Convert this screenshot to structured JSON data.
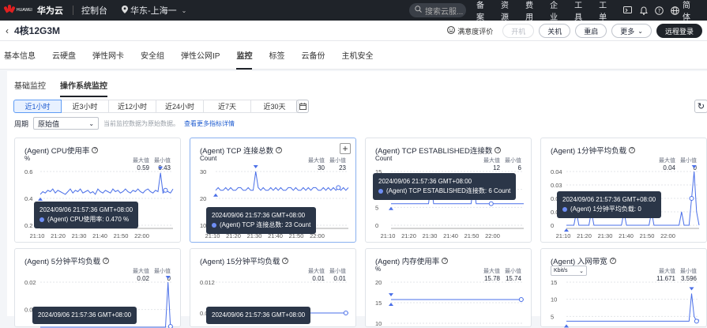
{
  "topbar": {
    "logo_text_line1": "HUAWEI",
    "brand": "华为云",
    "console": "控制台",
    "region": "华东-上海一",
    "search_placeholder": "搜索云服...",
    "links": [
      "备案",
      "资源",
      "费用",
      "企业",
      "工具",
      "工单"
    ],
    "lang": "简体"
  },
  "header": {
    "instance_title": "4核12G3M",
    "rate_label": "满意度评价",
    "buttons": [
      "开机",
      "关机",
      "重启",
      "更多",
      "远程登录"
    ]
  },
  "tabs": [
    "基本信息",
    "云硬盘",
    "弹性网卡",
    "安全组",
    "弹性公网IP",
    "监控",
    "标签",
    "云备份",
    "主机安全"
  ],
  "active_tab": "监控",
  "subtabs": [
    "基础监控",
    "操作系统监控"
  ],
  "active_subtab": "操作系统监控",
  "time_ranges": [
    "近1小时",
    "近3小时",
    "近12小时",
    "近24小时",
    "近7天",
    "近30天"
  ],
  "active_range": "近1小时",
  "period": {
    "label": "周期",
    "value": "原始值",
    "hint": "当前监控数据为原始数据。",
    "link": "查看更多指标详情"
  },
  "stat_labels": {
    "max": "最大值",
    "min": "最小值"
  },
  "cards": [
    {
      "title": "(Agent) CPU使用率",
      "unit": "%",
      "max": "0.59",
      "min": "0.43",
      "y_ticks": [
        "0.6",
        "0.4",
        "0.2"
      ],
      "x_ticks": [
        "21:10",
        "21:20",
        "21:30",
        "21:40",
        "21:50",
        "22:00"
      ],
      "tooltip_time": "2024/09/06 21:57:36 GMT+08:00",
      "tooltip_value": "(Agent) CPU使用率: 0.470 %",
      "series": [
        0.43,
        0.45,
        0.44,
        0.46,
        0.45,
        0.47,
        0.44,
        0.46,
        0.45,
        0.44,
        0.43,
        0.45,
        0.47,
        0.44,
        0.46,
        0.45,
        0.47,
        0.44,
        0.45,
        0.46,
        0.44,
        0.45,
        0.43,
        0.47,
        0.45,
        0.44,
        0.46,
        0.45,
        0.44,
        0.47,
        0.45,
        0.46,
        0.44,
        0.45,
        0.47,
        0.45,
        0.44,
        0.46,
        0.45,
        0.47,
        0.45,
        0.44,
        0.46,
        0.47,
        0.45,
        0.44,
        0.46,
        0.45,
        0.59,
        0.44,
        0.46,
        0.45,
        0.44,
        0.47
      ]
    },
    {
      "title": "(Agent) TCP 连接总数",
      "unit": "Count",
      "max": "30",
      "min": "23",
      "y_ticks": [
        "30",
        "20",
        "10"
      ],
      "x_ticks": [
        "21:10",
        "21:20",
        "21:30",
        "21:40",
        "21:50",
        "22:00"
      ],
      "tooltip_time": "2024/09/06 21:57:36 GMT+08:00",
      "tooltip_value": "(Agent) TCP 连接总数: 23 Count",
      "series": [
        23,
        24,
        23,
        23,
        24,
        23,
        24,
        23,
        23,
        24,
        24,
        23,
        23,
        24,
        23,
        23,
        30,
        24,
        23,
        24,
        23,
        23,
        24,
        23,
        24,
        23,
        24,
        23,
        23,
        24,
        24,
        23,
        24,
        23,
        23,
        24,
        23,
        24,
        23,
        24,
        24,
        23,
        23,
        24,
        23,
        24,
        23,
        24,
        23,
        24,
        23,
        24,
        23,
        24
      ]
    },
    {
      "title": "(Agent) TCP ESTABLISHED连接数",
      "unit": "Count",
      "max": "12",
      "min": "6",
      "y_ticks": [
        "15",
        "10",
        "5",
        "0"
      ],
      "x_ticks": [
        "21:10",
        "21:20",
        "21:30",
        "21:40",
        "21:50",
        "22:00"
      ],
      "tooltip_time": "2024/09/06 21:57:36 GMT+08:00",
      "tooltip_value": "(Agent) TCP ESTABLISHED连接数: 6 Count",
      "series": [
        6,
        6,
        6,
        6,
        6,
        6,
        6,
        6,
        6,
        6,
        6,
        6,
        6,
        6,
        6,
        6,
        12,
        6,
        6,
        6,
        6,
        6,
        6,
        6,
        6,
        6,
        6,
        6,
        6,
        6,
        6,
        6,
        6,
        12,
        6,
        6,
        6,
        6,
        6,
        6,
        6,
        6,
        6,
        6,
        6,
        6,
        6,
        6,
        6,
        6,
        6,
        6,
        6,
        6
      ]
    },
    {
      "title": "(Agent) 1分钟平均负载",
      "unit": "",
      "max": "0.04",
      "min": "0",
      "y_ticks": [
        "0.04",
        "0.03",
        "0.02",
        "0.01",
        "0"
      ],
      "x_ticks": [
        "21:10",
        "21:20",
        "21:30",
        "21:40",
        "21:50",
        "22:00"
      ],
      "tooltip_time": "2024/09/06 21:57:36 GMT+08:00",
      "tooltip_value": "(Agent) 1分钟平均负载: 0",
      "series": [
        0,
        0,
        0,
        0,
        0.01,
        0,
        0,
        0,
        0,
        0,
        0.01,
        0,
        0,
        0,
        0,
        0,
        0,
        0,
        0,
        0,
        0,
        0,
        0,
        0.01,
        0,
        0,
        0,
        0,
        0,
        0,
        0,
        0,
        0,
        0,
        0.01,
        0,
        0,
        0,
        0,
        0,
        0,
        0,
        0,
        0,
        0,
        0,
        0.01,
        0,
        0,
        0,
        0.02,
        0.04,
        0.01,
        0
      ]
    },
    {
      "title": "(Agent) 5分钟平均负载",
      "unit": "",
      "max": "0.02",
      "min": "0",
      "y_ticks": [
        "0.02",
        "0.015"
      ],
      "x_ticks": [],
      "tooltip_time": "2024/09/06 21:57:36 GMT+08:00",
      "tooltip_value": "",
      "series": [
        0,
        0,
        0,
        0,
        0,
        0,
        0,
        0,
        0,
        0,
        0,
        0,
        0,
        0,
        0,
        0,
        0,
        0,
        0,
        0,
        0,
        0,
        0,
        0,
        0,
        0,
        0,
        0,
        0,
        0,
        0,
        0,
        0,
        0,
        0,
        0,
        0,
        0,
        0,
        0,
        0,
        0,
        0,
        0,
        0,
        0,
        0,
        0,
        0,
        0,
        0.01,
        0.02,
        0.005,
        0
      ]
    },
    {
      "title": "(Agent) 15分钟平均负载",
      "unit": "",
      "max": "0.01",
      "min": "0.01",
      "y_ticks": [
        "0.012",
        "0.009"
      ],
      "x_ticks": [],
      "tooltip_time": "2024/09/06 21:57:36 GMT+08:00",
      "tooltip_value": "",
      "series": [
        0.009,
        0.009,
        0.009,
        0.009,
        0.009,
        0.009,
        0.009,
        0.009,
        0.009,
        0.009,
        0.009,
        0.009,
        0.009,
        0.009,
        0.009,
        0.009,
        0.009,
        0.009,
        0.009,
        0.009,
        0.009,
        0.009,
        0.009,
        0.009,
        0.009,
        0.009,
        0.009,
        0.009,
        0.009,
        0.009,
        0.009,
        0.009,
        0.009,
        0.009,
        0.009,
        0.009,
        0.009,
        0.009,
        0.009,
        0.009,
        0.009,
        0.009,
        0.009,
        0.009,
        0.009,
        0.009,
        0.009,
        0.009,
        0.009,
        0.009,
        0.009,
        0.009,
        0.009,
        0.009
      ]
    },
    {
      "title": "(Agent) 内存使用率",
      "unit": "%",
      "max": "15.78",
      "min": "15.74",
      "y_ticks": [
        "20",
        "15",
        "10"
      ],
      "x_ticks": [],
      "tooltip_time": "",
      "tooltip_value": "",
      "series": [
        15.76,
        15.76,
        15.76,
        15.76,
        15.76,
        15.76,
        15.76,
        15.76,
        15.76,
        15.76,
        15.76,
        15.76,
        15.76,
        15.76,
        15.76,
        15.76,
        15.76,
        15.76,
        15.76,
        15.76,
        15.76,
        15.76,
        15.76,
        15.76,
        15.76,
        15.76,
        15.76,
        15.76,
        15.76,
        15.76,
        15.76,
        15.76,
        15.76,
        15.76,
        15.76,
        15.76,
        15.76,
        15.76,
        15.76,
        15.76,
        15.76,
        15.76,
        15.76,
        15.76,
        15.76,
        15.76,
        15.76,
        15.76,
        15.76,
        15.76,
        15.76,
        15.76,
        15.76,
        15.76
      ]
    },
    {
      "title": "(Agent) 入网带宽",
      "unit": "Kbit/s",
      "max": "11.671",
      "min": "3.596",
      "y_ticks": [
        "15",
        "10",
        "5"
      ],
      "x_ticks": [],
      "tooltip_time": "",
      "tooltip_value": "",
      "series": [
        3.6,
        3.6,
        3.6,
        3.6,
        3.6,
        3.6,
        3.6,
        3.6,
        3.6,
        3.6,
        3.6,
        3.6,
        3.6,
        3.6,
        3.6,
        3.6,
        3.6,
        3.6,
        3.6,
        3.6,
        3.6,
        3.6,
        3.6,
        3.6,
        3.6,
        3.6,
        3.6,
        3.6,
        3.6,
        3.6,
        3.6,
        3.6,
        3.6,
        3.6,
        3.6,
        3.6,
        3.6,
        3.6,
        3.6,
        3.6,
        3.6,
        3.6,
        3.6,
        3.6,
        3.6,
        3.6,
        3.6,
        3.6,
        3.6,
        3.6,
        11.67,
        5,
        3.6,
        4
      ]
    }
  ],
  "colors": {
    "line": "#4a6fe8",
    "accent": "#1f5cd0",
    "topbar": "#1f2329"
  }
}
